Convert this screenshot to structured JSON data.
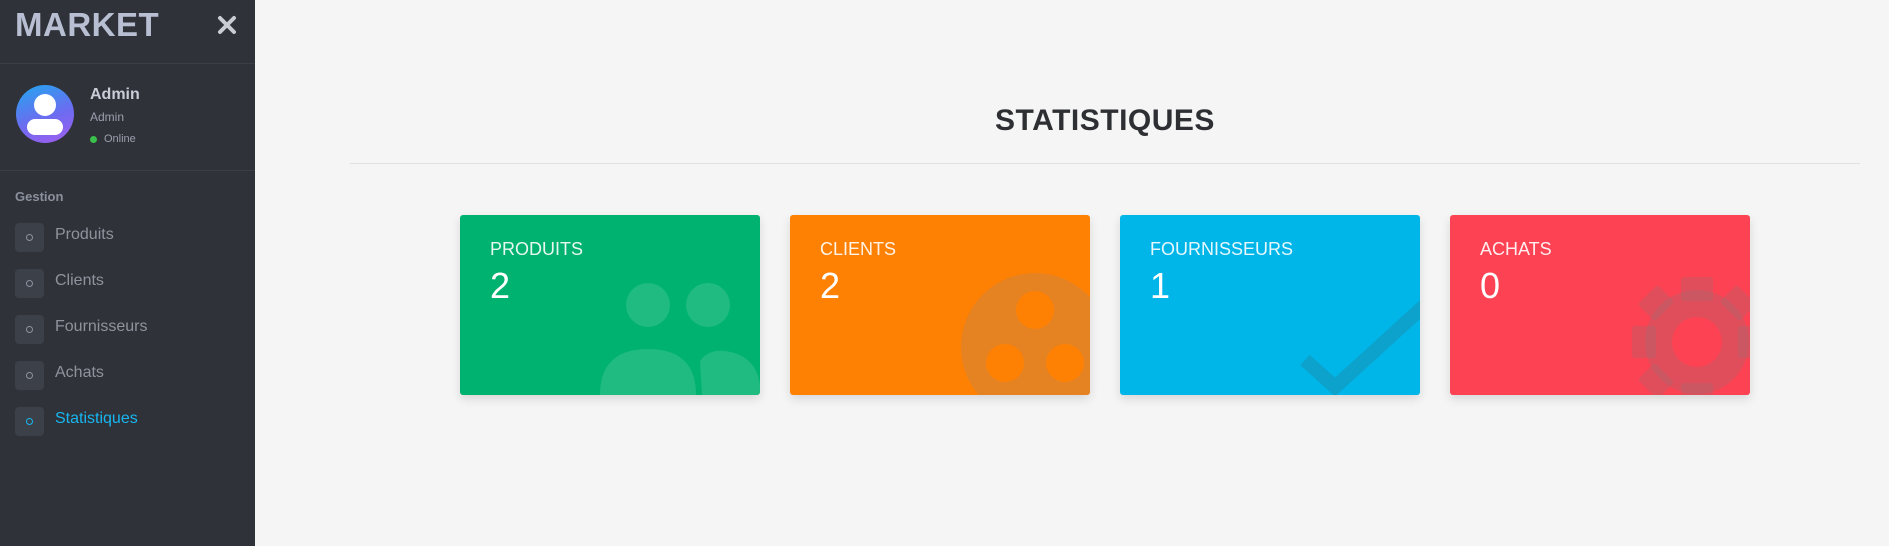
{
  "app": {
    "brand": "MARKET"
  },
  "profile": {
    "name": "Admin",
    "role": "Admin",
    "status": "Online"
  },
  "sidebar": {
    "section": "Gestion",
    "items": [
      {
        "label": "Produits",
        "active": false
      },
      {
        "label": "Clients",
        "active": false
      },
      {
        "label": "Fournisseurs",
        "active": false
      },
      {
        "label": "Achats",
        "active": false
      },
      {
        "label": "Statistiques",
        "active": true
      }
    ]
  },
  "main": {
    "title": "STATISTIQUES",
    "cards": [
      {
        "label": "PRODUITS",
        "value": "2",
        "color": "#00b26f",
        "icon": "users-icon"
      },
      {
        "label": "CLIENTS",
        "value": "2",
        "color": "#ff8104",
        "icon": "group-circle-icon"
      },
      {
        "label": "FOURNISSEURS",
        "value": "1",
        "color": "#00b6e9",
        "icon": "check-icon"
      },
      {
        "label": "ACHATS",
        "value": "0",
        "color": "#fd4253",
        "icon": "gear-icon"
      }
    ]
  },
  "colors": {
    "sidebar_bg": "#2f3238",
    "accent": "#17b6f0",
    "online": "#3cc04d"
  }
}
